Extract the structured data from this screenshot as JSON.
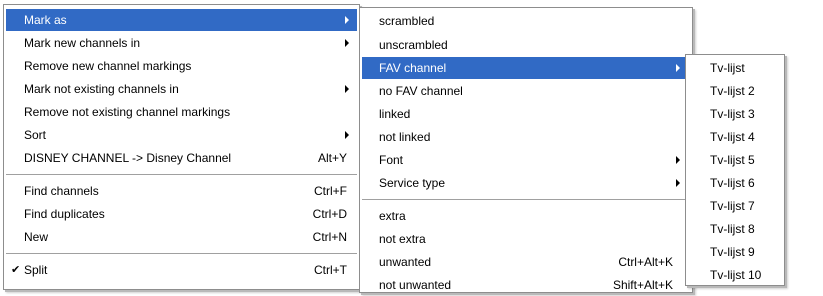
{
  "main_menu": {
    "items": [
      {
        "label": "Mark as",
        "shortcut": "",
        "submenu": true,
        "highlighted": true
      },
      {
        "label": "Mark new channels in",
        "shortcut": "",
        "submenu": true
      },
      {
        "label": "Remove new channel markings",
        "shortcut": ""
      },
      {
        "label": "Mark not existing channels in",
        "shortcut": "",
        "submenu": true
      },
      {
        "label": "Remove not existing channel markings",
        "shortcut": ""
      },
      {
        "label": "Sort",
        "shortcut": "",
        "submenu": true
      },
      {
        "label": "DISNEY CHANNEL -> Disney Channel",
        "shortcut": "Alt+Y"
      },
      {
        "label": "Find channels",
        "shortcut": "Ctrl+F"
      },
      {
        "label": "Find duplicates",
        "shortcut": "Ctrl+D"
      },
      {
        "label": "New",
        "shortcut": "Ctrl+N"
      },
      {
        "label": "Split",
        "shortcut": "Ctrl+T",
        "checked": true
      }
    ]
  },
  "mark_as_menu": {
    "items": [
      {
        "label": "scrambled",
        "shortcut": ""
      },
      {
        "label": "unscrambled",
        "shortcut": ""
      },
      {
        "label": "FAV channel",
        "shortcut": "",
        "submenu": true,
        "highlighted": true
      },
      {
        "label": "no FAV channel",
        "shortcut": ""
      },
      {
        "label": "linked",
        "shortcut": ""
      },
      {
        "label": "not linked",
        "shortcut": ""
      },
      {
        "label": "Font",
        "shortcut": "",
        "submenu": true
      },
      {
        "label": "Service type",
        "shortcut": "",
        "submenu": true
      },
      {
        "label": "extra",
        "shortcut": ""
      },
      {
        "label": "not extra",
        "shortcut": ""
      },
      {
        "label": "unwanted",
        "shortcut": "Ctrl+Alt+K"
      },
      {
        "label": "not unwanted",
        "shortcut": "Shift+Alt+K"
      }
    ]
  },
  "fav_menu": {
    "items": [
      {
        "label": "Tv-lijst"
      },
      {
        "label": "Tv-lijst 2"
      },
      {
        "label": "Tv-lijst 3"
      },
      {
        "label": "Tv-lijst 4"
      },
      {
        "label": "Tv-lijst 5"
      },
      {
        "label": "Tv-lijst 6"
      },
      {
        "label": "Tv-lijst 7"
      },
      {
        "label": "Tv-lijst 8"
      },
      {
        "label": "Tv-lijst 9"
      },
      {
        "label": "Tv-lijst 10"
      }
    ]
  },
  "colors": {
    "highlight": "#316ac5",
    "highlight_text": "#ffffff"
  },
  "icons": {
    "checkmark": "checkmark-icon",
    "submenu_arrow": "submenu-arrow-icon"
  }
}
